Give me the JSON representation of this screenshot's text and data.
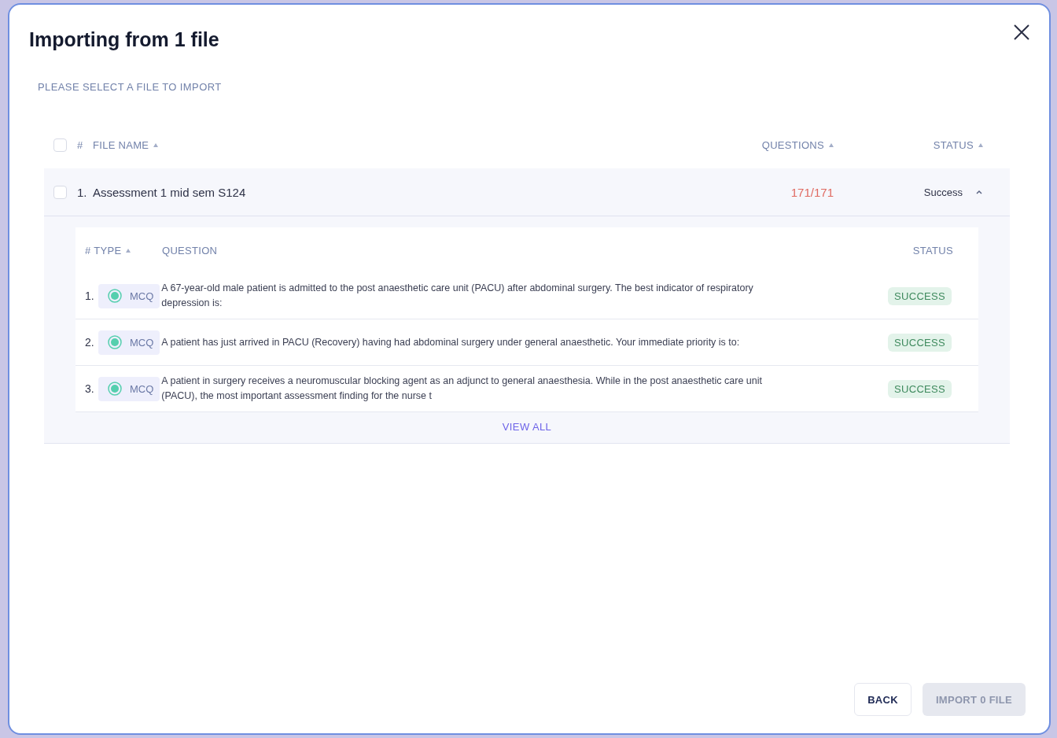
{
  "dialog": {
    "title": "Importing from 1 file",
    "subtitle": "PLEASE SELECT A FILE TO IMPORT"
  },
  "table": {
    "select_all": {
      "checked": false
    },
    "columns": [
      {
        "label": "#",
        "sortable": false
      },
      {
        "label": "FILE NAME",
        "sortable": true
      },
      {
        "label": "QUESTIONS",
        "sortable": true
      },
      {
        "label": "STATUS",
        "sortable": true
      }
    ],
    "rows": [
      {
        "checked": false,
        "index": "1.",
        "name": "Assessment 1 mid sem S124",
        "questions": "171/171",
        "status": "Success",
        "expanded": true,
        "detail": {
          "columns": [
            {
              "label": "# TYPE",
              "sortable": true
            },
            {
              "label": "QUESTION",
              "sortable": false
            },
            {
              "label": "STATUS",
              "sortable": false
            }
          ],
          "rows": [
            {
              "index": "1.",
              "type": "MCQ",
              "question": "A 67-year-old male patient is admitted to the post anaesthetic care unit (PACU) after abdominal surgery. The best indicator of respiratory depression is:",
              "status": "SUCCESS"
            },
            {
              "index": "2.",
              "type": "MCQ",
              "question": "A patient has just arrived in PACU (Recovery) having had abdominal surgery under general anaesthetic. Your immediate priority is to:",
              "status": "SUCCESS"
            },
            {
              "index": "3.",
              "type": "MCQ",
              "question": "A patient in surgery receives a neuromuscular blocking agent as an adjunct to general anaesthesia. While in the post anaesthetic care unit (PACU), the most important assessment finding for the nurse t",
              "status": "SUCCESS"
            }
          ],
          "view_all": "VIEW ALL"
        }
      }
    ]
  },
  "buttons": [
    {
      "label": "BACK",
      "disabled": false
    },
    {
      "label": "IMPORT 0 FILE",
      "disabled": true
    }
  ]
}
